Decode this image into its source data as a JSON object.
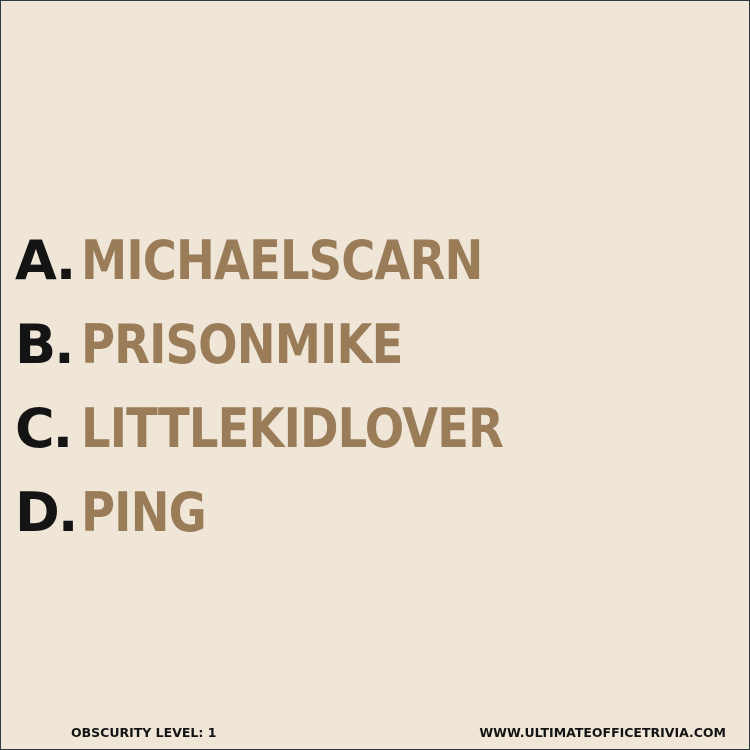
{
  "options": [
    {
      "letter": "A.",
      "answer": "MICHAELSCARN"
    },
    {
      "letter": "B.",
      "answer": "PRISONMIKE"
    },
    {
      "letter": "C.",
      "answer": "LITTLEKIDLOVER"
    },
    {
      "letter": "D.",
      "answer": "PING"
    }
  ],
  "footer": {
    "level": "OBSCURITY LEVEL: 1",
    "website": "WWW.ULTIMATEOFFICETRIVIA.COM"
  },
  "colors": {
    "background": "#efe6d8",
    "letter": "#141414",
    "answer": "#9a7c59"
  }
}
